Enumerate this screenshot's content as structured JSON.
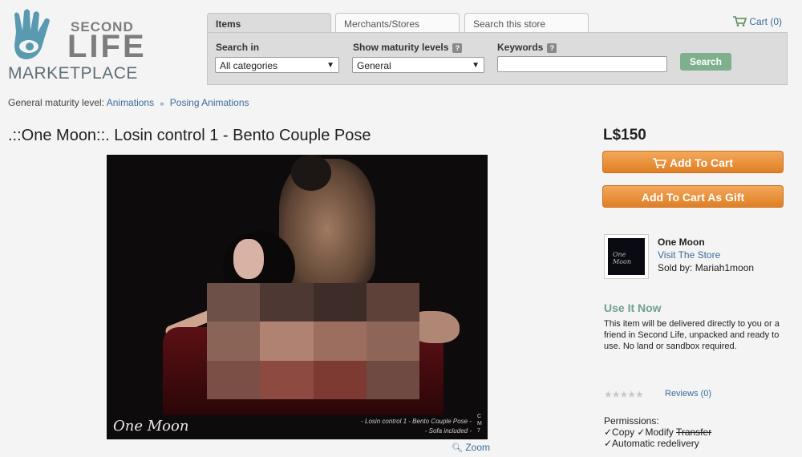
{
  "logo": {
    "line1": "SECOND",
    "line2": "LIFE",
    "line3": "MARKETPLACE"
  },
  "tabs": [
    {
      "label": "Items",
      "active": true
    },
    {
      "label": "Merchants/Stores",
      "active": false
    },
    {
      "label": "Search this store",
      "active": false
    }
  ],
  "search": {
    "search_in_label": "Search in",
    "search_in_value": "All categories",
    "maturity_label": "Show maturity levels",
    "maturity_value": "General",
    "keywords_label": "Keywords",
    "keywords_value": "",
    "button_label": "Search",
    "help_glyph": "?"
  },
  "cart": {
    "label": "Cart (0)"
  },
  "breadcrumb": {
    "prefix": "General maturity level:",
    "items": [
      "Animations",
      "Posing Animations"
    ],
    "separator": "»"
  },
  "product": {
    "title": ".::One Moon::. Losin control 1 - Bento Couple Pose",
    "image_logo": "One Moon",
    "image_caption_line1": "- Losin control 1 - Bento Couple Pose -",
    "image_caption_line2": "- Sofa included -",
    "image_caption_side": "CM7",
    "zoom_label": "Zoom"
  },
  "purchase": {
    "price": "L$150",
    "add_to_cart": "Add To Cart",
    "add_as_gift": "Add To Cart As Gift"
  },
  "merchant": {
    "name": "One Moon",
    "visit_store": "Visit The Store",
    "sold_by": "Sold by: Mariah1moon",
    "logo_text": "One Moon"
  },
  "use_it_now": {
    "heading": "Use It Now",
    "description": "This item will be delivered directly to you or a friend in Second Life, unpacked and ready to use. No land or sandbox required."
  },
  "reviews": {
    "stars_glyph": "★★★★★",
    "rating": 0,
    "label": "Reviews (0)"
  },
  "permissions": {
    "label": "Permissions:",
    "copy": "✓Copy",
    "modify": "✓Modify",
    "transfer": "Transfer",
    "delivery": "✓Automatic redelivery"
  },
  "colors": {
    "accent_link": "#3a6b9a",
    "orange_button": "#e88f35",
    "search_button": "#7fb08e",
    "use_it_now": "#6fa093"
  }
}
